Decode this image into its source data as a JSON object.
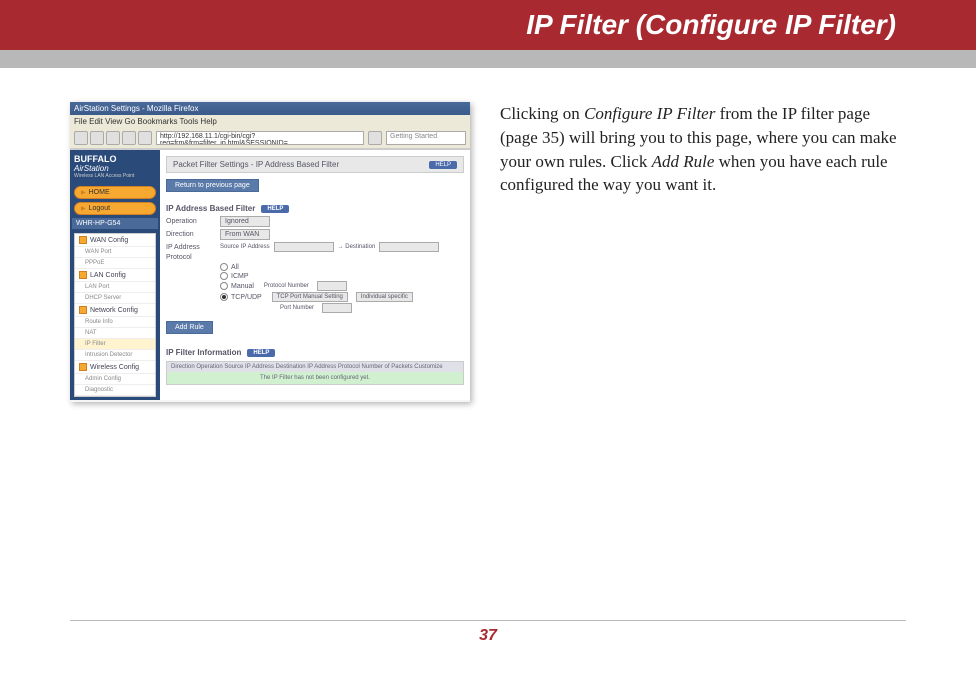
{
  "header": {
    "title": "IP Filter (Configure IP Filter)"
  },
  "body": {
    "text_1": "Clicking on ",
    "em_1": "Configure IP Filter",
    "text_2": " from the IP filter page (page 35) will bring you to this page, where you can make your own rules. Click ",
    "em_2": "Add Rule",
    "text_3": " when you have each rule configured the way you want it."
  },
  "screenshot": {
    "titlebar": "AirStation Settings - Mozilla Firefox",
    "menubar": "File  Edit  View  Go  Bookmarks  Tools  Help",
    "address": "http://192.168.11.1/cgi-bin/cgi?req=frm&frm=filter_ip.html&SESSIONID=",
    "search": "Getting Started",
    "logo_brand": "BUFFALO",
    "logo_product": "AirStation",
    "logo_tag": "Wireless LAN Access Point",
    "home_btn": "HOME",
    "logout_btn": "Logout",
    "model": "WHR-HP-G54",
    "nav": {
      "wan": "WAN Config",
      "wan_port": "WAN Port",
      "pppoe": "PPPoE",
      "lan": "LAN Config",
      "lan_port": "LAN Port",
      "dhcp": "DHCP Server",
      "network": "Network Config",
      "route": "Route Info",
      "nat": "NAT",
      "ipfilter": "IP Filter",
      "intrusion": "Intrusion Detector",
      "wireless": "Wireless Config",
      "admin": "Admin Config",
      "diag": "Diagnostic"
    },
    "panel_title": "Packet Filter Settings - IP Address Based Filter",
    "help": "HELP",
    "return_btn": "Return to previous page",
    "section_ip": "IP Address Based Filter",
    "form": {
      "operation_label": "Operation",
      "operation_value": "Ignored",
      "direction_label": "Direction",
      "direction_value": "From WAN",
      "ip_label": "IP Address",
      "ip_source": "Source IP Address",
      "ip_dest": "→ Destination",
      "proto_label": "Protocol",
      "proto_all": "All",
      "proto_icmp": "ICMP",
      "proto_manual": "Manual",
      "proto_number": "Protocol Number",
      "proto_tcpudp": "TCP/UDP",
      "port_setting": "TCP Port Manual Setting",
      "port_dropdown": "Individual specific",
      "port_number": "Port Number"
    },
    "add_btn": "Add Rule",
    "section_info": "IP Filter Information",
    "table_header": "Direction Operation Source IP Address Destination IP Address Protocol Number of Packets Customize",
    "table_body": "The IP Filter has not been configured yet."
  },
  "footer": {
    "page": "37"
  }
}
